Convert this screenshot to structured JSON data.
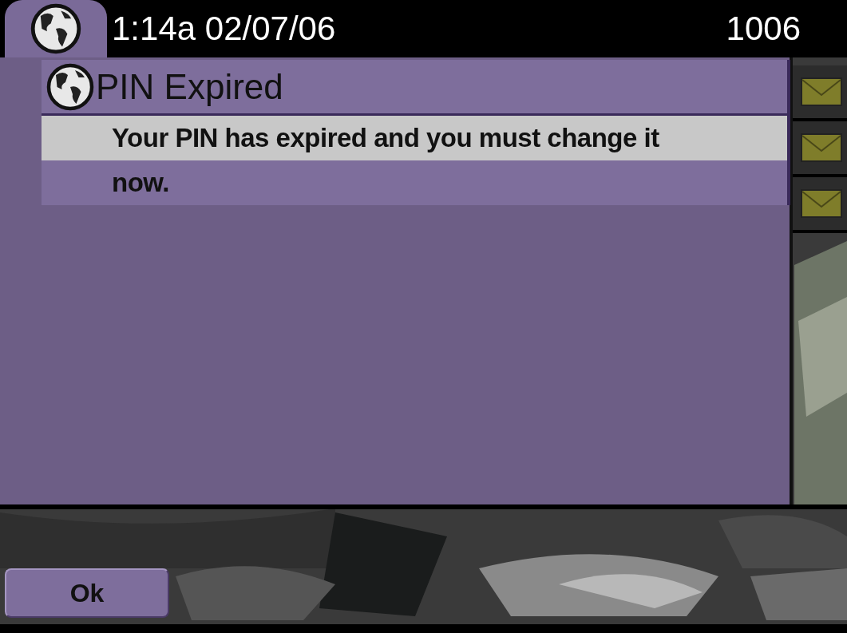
{
  "status_bar": {
    "time": "1:14a",
    "date": "02/07/06",
    "line_number": "1006"
  },
  "dialog": {
    "title": "PIN Expired",
    "lines": [
      {
        "text": "Your PIN has expired and you must change it",
        "selected": true
      },
      {
        "text": "now.",
        "selected": false
      }
    ]
  },
  "line_buttons": [
    {
      "kind": "message"
    },
    {
      "kind": "message"
    },
    {
      "kind": "message"
    }
  ],
  "softkeys": [
    {
      "label": "Ok"
    }
  ]
}
